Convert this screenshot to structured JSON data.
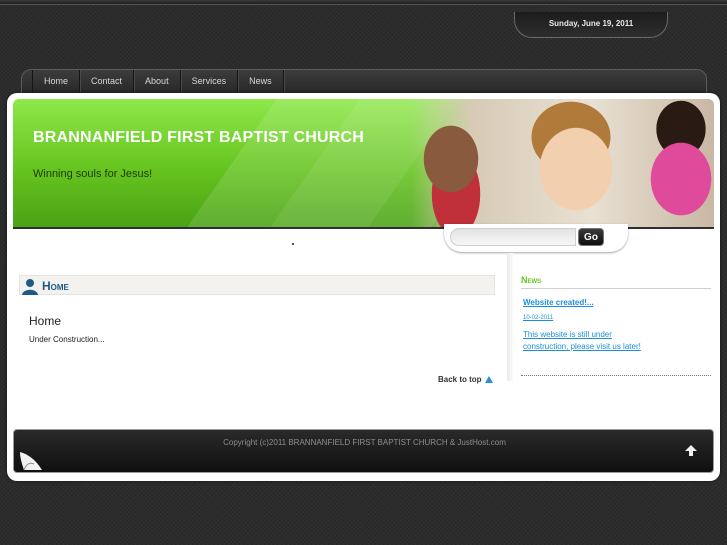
{
  "date": "Sunday, June 19, 2011",
  "nav": {
    "items": [
      {
        "label": "Home"
      },
      {
        "label": "Contact"
      },
      {
        "label": "About"
      },
      {
        "label": "Services"
      },
      {
        "label": "News"
      }
    ]
  },
  "header": {
    "title": "BRANNANFIELD FIRST BAPTIST CHURCH",
    "tagline": "Winning souls for Jesus!"
  },
  "search": {
    "value": "",
    "button_label": "Go"
  },
  "main": {
    "heading": "Home",
    "title": "Home",
    "body": "Under Construction...",
    "back_to_top": "Back to top"
  },
  "sidebar": {
    "heading": "News",
    "items": [
      {
        "title": "Website created!...",
        "date": "10-02-2011",
        "text": "This website is still under construction, please visit us later!"
      }
    ]
  },
  "footer": {
    "copyright": "Copyright (c)2011 BRANNANFIELD FIRST BAPTIST CHURCH & JustHost.com"
  },
  "colors": {
    "accent_green": "#66c41f",
    "link_blue": "#1e8ed8",
    "heading_blue": "#1f5a87"
  }
}
